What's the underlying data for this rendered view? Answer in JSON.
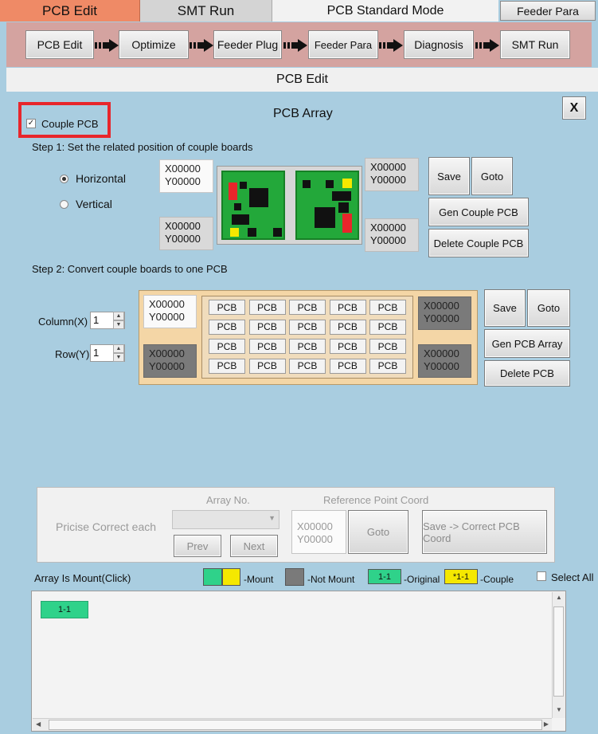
{
  "tabs": {
    "pcb_edit": "PCB Edit",
    "smt_run": "SMT Run",
    "mode": "PCB Standard Mode",
    "feeder_para": "Feeder Para"
  },
  "workflow": [
    "PCB Edit",
    "Optimize",
    "Feeder Plug",
    "Feeder Para",
    "Diagnosis",
    "SMT Run"
  ],
  "section_title": "PCB Edit",
  "dialog": {
    "title": "PCB Array",
    "close": "X",
    "couple_pcb": "Couple PCB",
    "step1": "Step 1: Set the related position of couple boards",
    "horizontal": "Horizontal",
    "vertical": "Vertical",
    "step2": "Step 2: Convert couple boards to one PCB",
    "column_label": "Column(X)",
    "row_label": "Row(Y)",
    "column_value": "1",
    "row_value": "1",
    "coords": {
      "s1_tl": {
        "x": "X00000",
        "y": "Y00000"
      },
      "s1_bl": {
        "x": "X00000",
        "y": "Y00000"
      },
      "s1_tr": {
        "x": "X00000",
        "y": "Y00000"
      },
      "s1_br": {
        "x": "X00000",
        "y": "Y00000"
      },
      "s2_tl": {
        "x": "X00000",
        "y": "Y00000"
      },
      "s2_bl": {
        "x": "X00000",
        "y": "Y00000"
      },
      "s2_tr": {
        "x": "X00000",
        "y": "Y00000"
      },
      "s2_br": {
        "x": "X00000",
        "y": "Y00000"
      },
      "ref": {
        "x": "X00000",
        "y": "Y00000"
      }
    },
    "save": "Save",
    "goto": "Goto",
    "gen_couple_pcb": "Gen Couple PCB",
    "delete_couple_pcb": "Delete Couple PCB",
    "gen_pcb_array": "Gen PCB Array",
    "delete_pcb": "Delete PCB",
    "pcb_cell": "PCB",
    "precise": {
      "label": "Pricise Correct each",
      "array_no": "Array No.",
      "ref_point": "Reference Point Coord",
      "prev": "Prev",
      "next": "Next",
      "goto": "Goto",
      "save_correct": "Save -> Correct PCB Coord"
    },
    "legend": {
      "array_mount": "Array Is Mount(Click)",
      "mount": "-Mount",
      "not_mount": "-Not Mount",
      "original_tag": "1-1",
      "original": "-Original",
      "couple_tag": "*1-1",
      "couple": "-Couple",
      "select_all": "Select All"
    },
    "list_items": [
      "1-1"
    ]
  },
  "colors": {
    "highlight": "#e8262b",
    "mount_green": "#2fd28a",
    "mount_yellow": "#f5e800",
    "not_mount": "#7a7a7a",
    "panel": "#a9cde0"
  }
}
